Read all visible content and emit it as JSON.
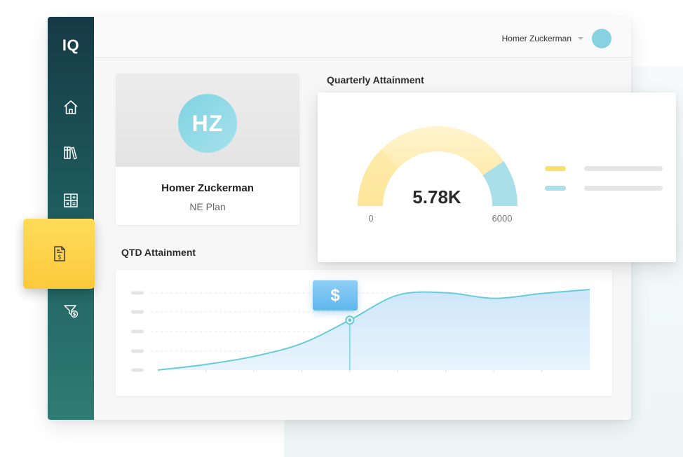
{
  "app": {
    "logo": "IQ"
  },
  "header": {
    "user_name": "Homer Zuckerman"
  },
  "sidebar": {
    "items": [
      {
        "name": "home",
        "icon": "home-icon"
      },
      {
        "name": "library",
        "icon": "books-icon"
      },
      {
        "name": "calculator",
        "icon": "calculator-icon"
      },
      {
        "name": "statements",
        "icon": "dollar-document-icon",
        "active": true
      },
      {
        "name": "filter",
        "icon": "dollar-filter-icon"
      }
    ]
  },
  "profile": {
    "initials": "HZ",
    "name": "Homer Zuckerman",
    "plan": "NE Plan"
  },
  "quarterly": {
    "title": "Quarterly Attainment",
    "value_label": "5.78K",
    "value": 5780,
    "min": 0,
    "max": 6000,
    "min_label": "0",
    "max_label": "6000",
    "colors": {
      "primary": "#fbe06a",
      "secondary": "#8dd6e2"
    }
  },
  "qtd": {
    "title": "QTD Attainment",
    "marker_label": "$",
    "chart_data": {
      "type": "area",
      "x": [
        0,
        1,
        2,
        3,
        4,
        5,
        6,
        7
      ],
      "y": [
        0.0,
        0.07,
        0.17,
        0.33,
        0.62,
        0.93,
        0.96,
        0.89,
        0.95,
        1.0
      ],
      "highlight_index": 4,
      "line_color": "#66ccd9",
      "fill_color": "#d7ecfb"
    }
  }
}
